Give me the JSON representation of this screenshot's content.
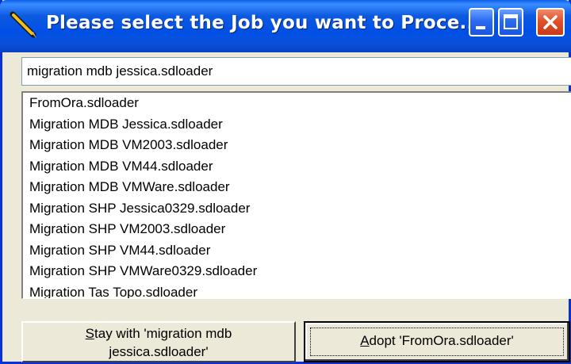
{
  "window": {
    "title": "Please select the Job you want to Proce...",
    "icon": "pencil-icon"
  },
  "title_buttons": {
    "minimize_icon": "minimize-icon",
    "maximize_icon": "maximize-icon",
    "close_icon": "close-icon"
  },
  "search": {
    "value": "migration mdb jessica.sdloader"
  },
  "list": {
    "items": [
      "FromOra.sdloader",
      "Migration MDB Jessica.sdloader",
      "Migration MDB VM2003.sdloader",
      "Migration MDB VM44.sdloader",
      "Migration MDB VMWare.sdloader",
      "Migration SHP Jessica0329.sdloader",
      "Migration SHP VM2003.sdloader",
      "Migration SHP VM44.sdloader",
      "Migration SHP VMWare0329.sdloader",
      "Migration Tas Topo.sdloader"
    ]
  },
  "buttons": {
    "stay_accel": "S",
    "stay_line1_rest": "tay with 'migration mdb",
    "stay_line2": "jessica.sdloader'",
    "adopt_accel": "A",
    "adopt_rest": "dopt 'FromOra.sdloader'"
  },
  "colors": {
    "titlebar": "#0050e6",
    "face": "#ece9d8",
    "close_button": "#e0502a"
  }
}
